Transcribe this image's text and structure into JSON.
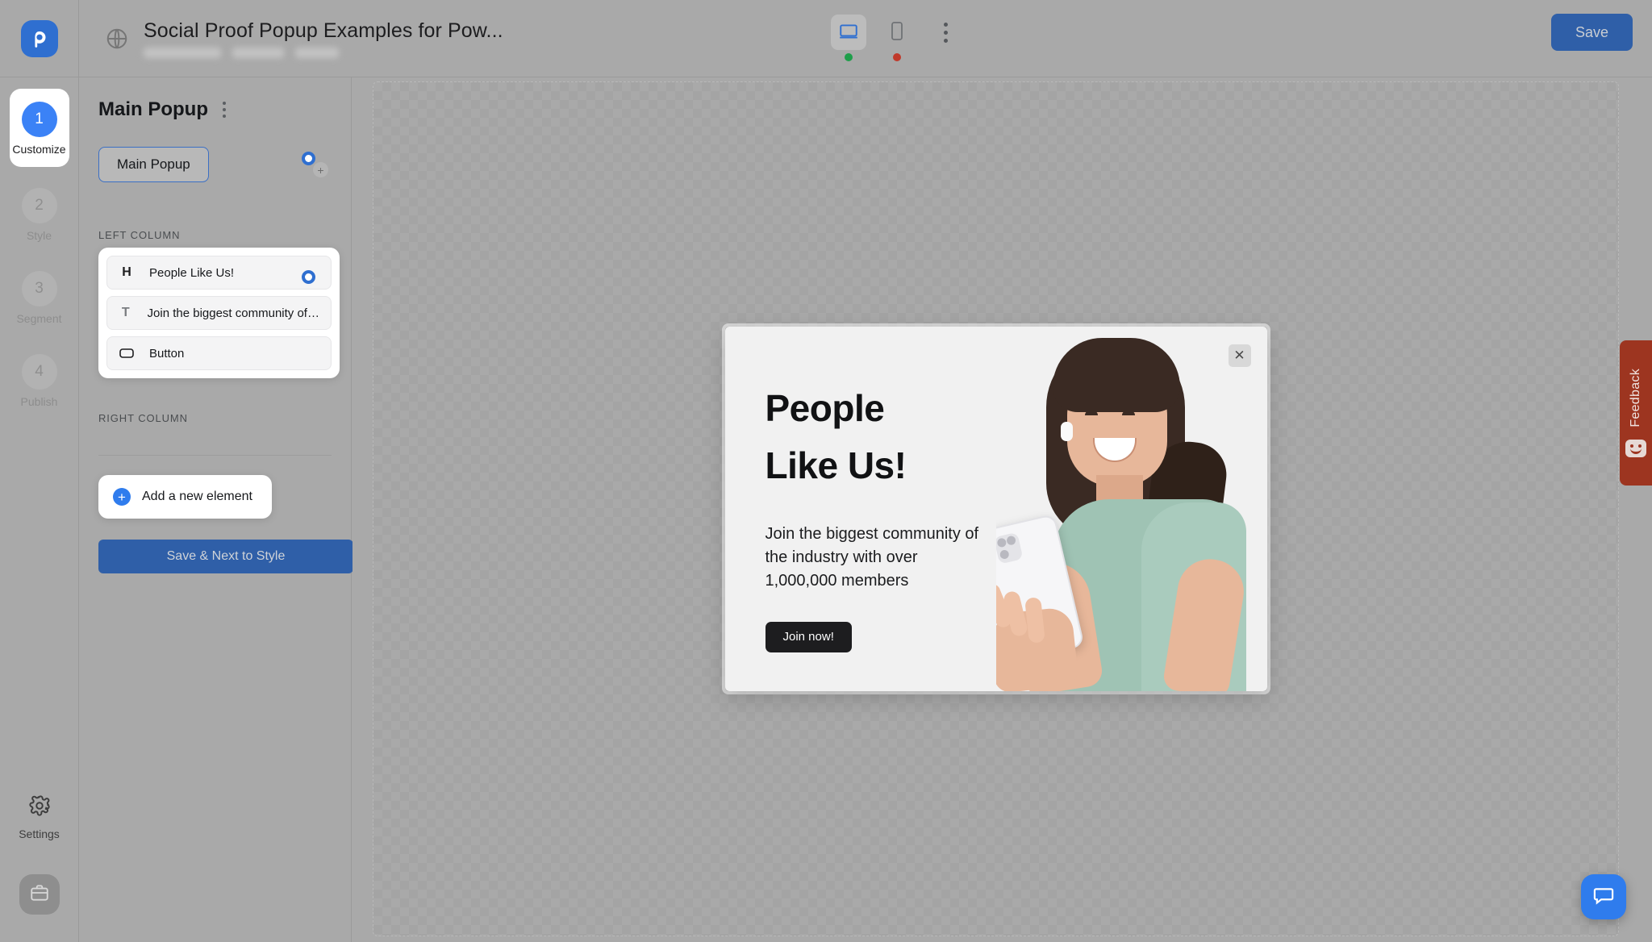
{
  "header": {
    "logo_icon": "popup-logo-icon",
    "site_icon": "globe-icon",
    "title": "Social Proof Popup Examples for Pow...",
    "save_label": "Save",
    "devices": [
      {
        "name": "desktop",
        "icon": "desktop-icon",
        "status_color": "#1e9e4a",
        "active": true
      },
      {
        "name": "mobile",
        "icon": "mobile-icon",
        "status_color": "#c0392b",
        "active": false
      }
    ],
    "more_icon": "kebab-menu-icon"
  },
  "rail": {
    "steps": [
      {
        "number": "1",
        "label": "Customize",
        "active": true
      },
      {
        "number": "2",
        "label": "Style",
        "active": false
      },
      {
        "number": "3",
        "label": "Segment",
        "active": false
      },
      {
        "number": "4",
        "label": "Publish",
        "active": false
      }
    ],
    "settings_label": "Settings",
    "settings_icon": "gear-icon",
    "briefcase_icon": "briefcase-icon"
  },
  "panel": {
    "title": "Main Popup",
    "more_icon": "kebab-menu-icon",
    "tab_label": "Main Popup",
    "left_column_label": "LEFT COLUMN",
    "right_column_label": "RIGHT COLUMN",
    "elements": [
      {
        "icon": "heading-icon",
        "glyph": "H",
        "label": "People Like Us!"
      },
      {
        "icon": "text-icon",
        "glyph": "T",
        "label": "Join the biggest community of the i..."
      },
      {
        "icon": "button-icon",
        "glyph": "",
        "label": "Button"
      }
    ],
    "add_element_label": "Add a new element",
    "add_icon": "plus-circle-icon",
    "save_next_label": "Save & Next to Style"
  },
  "popup": {
    "heading_line1": "People",
    "heading_line2": "Like Us!",
    "body": "Join the biggest community of the industry with over 1,000,000 members",
    "cta_label": "Join now!",
    "close_icon": "close-icon",
    "image_alt": "woman-with-phone-photo"
  },
  "feedback": {
    "label": "Feedback",
    "icon": "smiley-icon",
    "color": "#9d3520"
  },
  "chat": {
    "icon": "chat-bubble-icon",
    "color": "#2f7ced"
  },
  "colors": {
    "accent_blue": "#2f6fd0",
    "save_blue": "#2f5fa8",
    "step_active": "#3b82f6",
    "cta_dark": "#1d1d1f"
  }
}
